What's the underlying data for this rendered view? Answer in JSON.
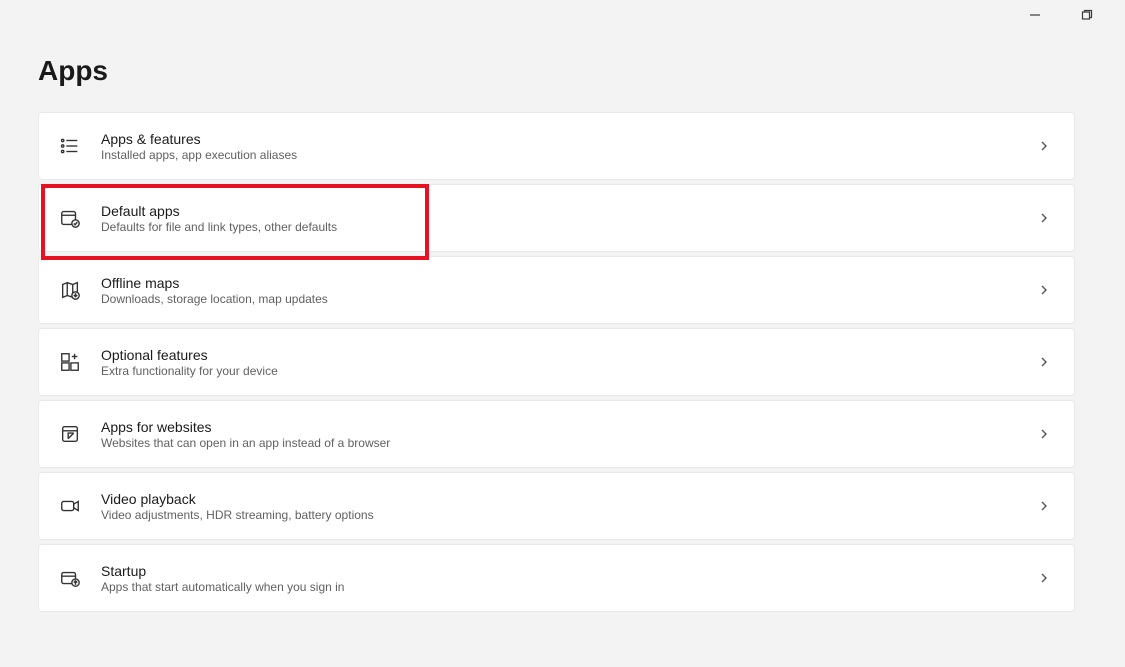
{
  "page": {
    "title": "Apps"
  },
  "items": [
    {
      "title": "Apps & features",
      "sub": "Installed apps, app execution aliases",
      "icon": "list-icon"
    },
    {
      "title": "Default apps",
      "sub": "Defaults for file and link types, other defaults",
      "icon": "default-apps-icon"
    },
    {
      "title": "Offline maps",
      "sub": "Downloads, storage location, map updates",
      "icon": "map-icon"
    },
    {
      "title": "Optional features",
      "sub": "Extra functionality for your device",
      "icon": "optional-features-icon"
    },
    {
      "title": "Apps for websites",
      "sub": "Websites that can open in an app instead of a browser",
      "icon": "website-apps-icon"
    },
    {
      "title": "Video playback",
      "sub": "Video adjustments, HDR streaming, battery options",
      "icon": "video-icon"
    },
    {
      "title": "Startup",
      "sub": "Apps that start automatically when you sign in",
      "icon": "startup-icon"
    }
  ],
  "highlighted_index": 1
}
